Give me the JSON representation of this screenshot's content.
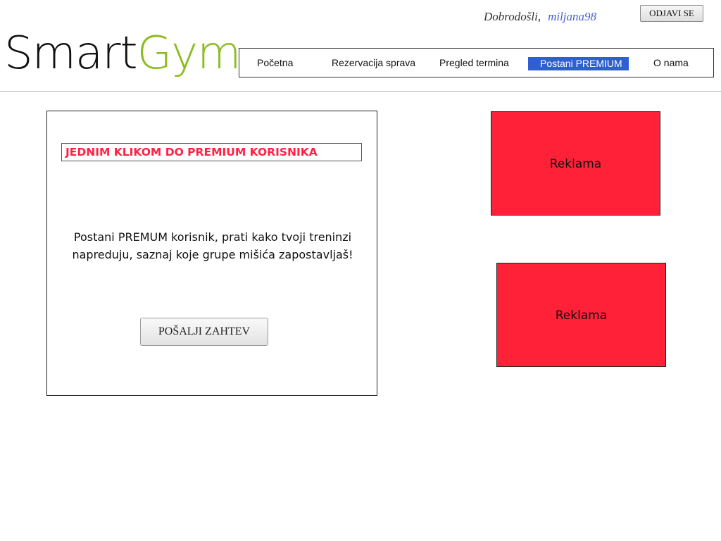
{
  "header": {
    "welcome_label": "Dobrodošli,",
    "username": "miljana98",
    "logout_label": "ODJAVI SE",
    "logo_part1": "Smart",
    "logo_part2": "Gym",
    "logo_colors": {
      "smart": "#111111",
      "gym": "#8cbc1f"
    }
  },
  "nav": {
    "items": [
      {
        "label": "Početna"
      },
      {
        "label": "Rezervacija sprava"
      },
      {
        "label": "Pregled termina"
      },
      {
        "label": "Postani PREMIUM",
        "active": true
      },
      {
        "label": "O nama"
      }
    ],
    "active_color": "#2f5fd0"
  },
  "main": {
    "title": "JEDNIM KLIKOM DO PREMIUM KORISNIKA",
    "title_color": "#ff2244",
    "description": "Postani PREMUM korisnik, prati kako tvoji treninzi napreduju, saznaj koje grupe mišića zapostavljaš!",
    "button_label": "POŠALJI ZAHTEV"
  },
  "ads": {
    "items": [
      {
        "label": "Reklama"
      },
      {
        "label": "Reklama"
      }
    ],
    "color": "#ff2138"
  }
}
